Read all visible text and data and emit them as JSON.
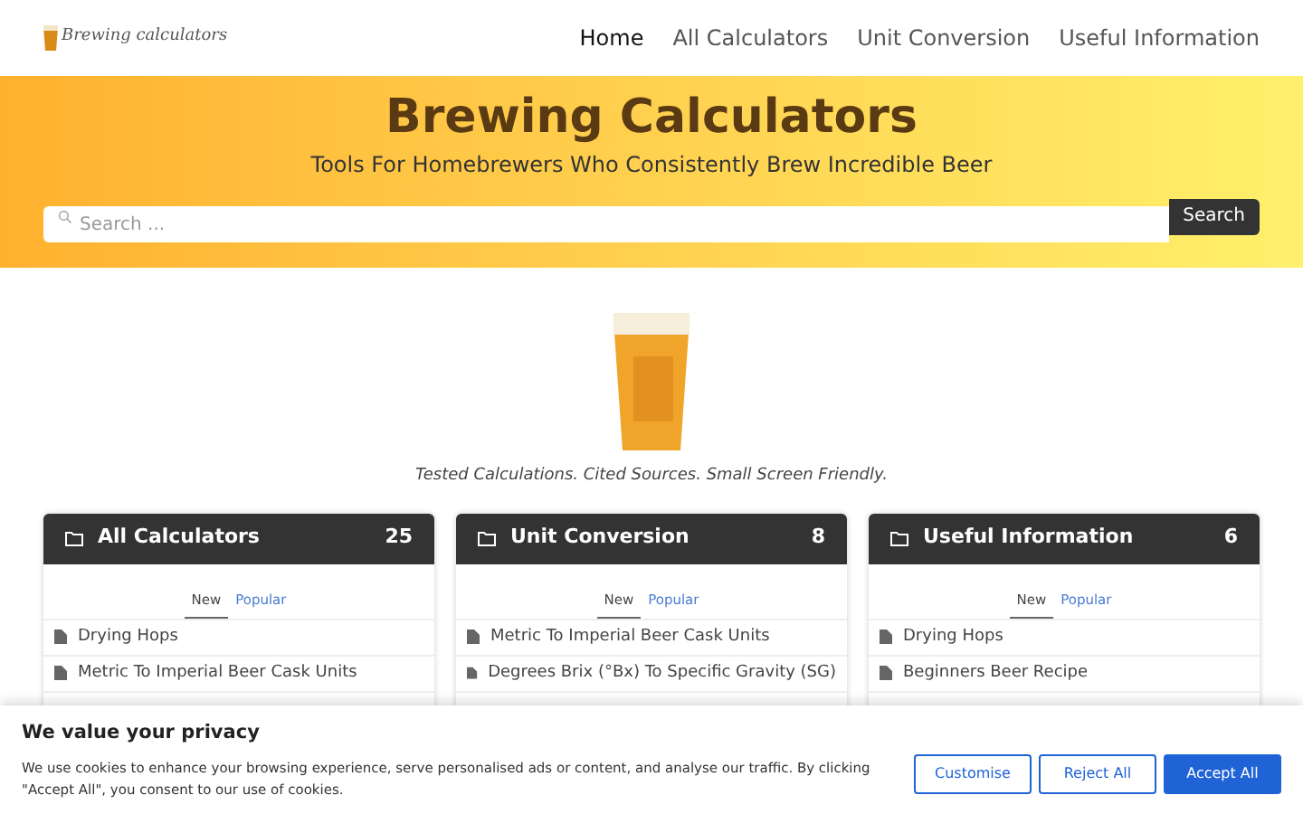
{
  "header": {
    "logo_text": "Brewing calculators",
    "nav": [
      {
        "label": "Home",
        "selected": true
      },
      {
        "label": "All Calculators",
        "selected": false
      },
      {
        "label": "Unit Conversion",
        "selected": false
      },
      {
        "label": "Useful Information",
        "selected": false
      }
    ]
  },
  "hero": {
    "title": "Brewing Calculators",
    "subtitle": "Tools For Homebrewers Who Consistently Brew Incredible Beer",
    "search": {
      "placeholder": "Search ...",
      "button": "Search"
    }
  },
  "tagline": "Tested Calculations. Cited Sources. Small Screen Friendly.",
  "cards": [
    {
      "title": "All Calculators",
      "count": "25",
      "tabs": [
        {
          "label": "New",
          "selected": true
        },
        {
          "label": "Popular",
          "selected": false
        }
      ],
      "items": [
        "Drying Hops",
        "Metric To Imperial Beer Cask Units"
      ]
    },
    {
      "title": "Unit Conversion",
      "count": "8",
      "tabs": [
        {
          "label": "New",
          "selected": true
        },
        {
          "label": "Popular",
          "selected": false
        }
      ],
      "items": [
        "Metric To Imperial Beer Cask Units",
        "Degrees Brix (°Bx) To Specific Gravity (SG)"
      ]
    },
    {
      "title": "Useful Information",
      "count": "6",
      "tabs": [
        {
          "label": "New",
          "selected": true
        },
        {
          "label": "Popular",
          "selected": false
        }
      ],
      "items": [
        "Drying Hops",
        "Beginners Beer Recipe"
      ]
    }
  ],
  "cookie_banner": {
    "title": "We value your privacy",
    "text": "We use cookies to enhance your browsing experience, serve personalised ads or content, and analyse our traffic. By clicking \"Accept All\", you consent to our use of cookies.",
    "buttons": [
      {
        "label": "Customise",
        "kind": "outline"
      },
      {
        "label": "Reject All",
        "kind": "outline"
      },
      {
        "label": "Accept All",
        "kind": "primary"
      }
    ]
  }
}
